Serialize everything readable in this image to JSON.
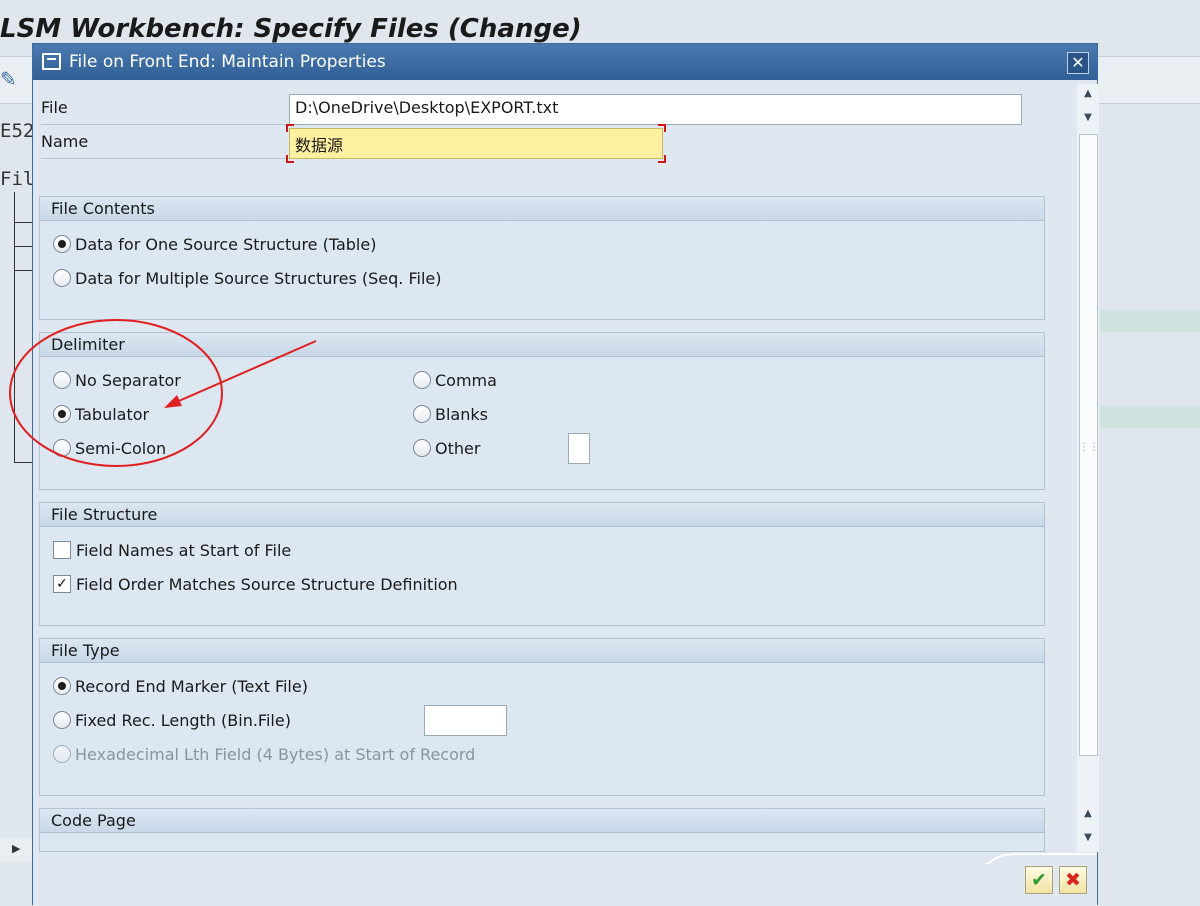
{
  "background": {
    "title": "LSM Workbench: Specify Files (Change)",
    "text_e52": "E52",
    "text_fil": "Fil"
  },
  "dialog": {
    "title": "File on Front End: Maintain Properties",
    "file_label": "File",
    "file_value": "D:\\OneDrive\\Desktop\\EXPORT.txt",
    "name_label": "Name",
    "name_value": "数据源",
    "file_contents": {
      "header": "File Contents",
      "options": [
        "Data for One Source Structure (Table)",
        "Data for Multiple Source Structures (Seq. File)"
      ],
      "selected": 0
    },
    "delimiter": {
      "header": "Delimiter",
      "options": [
        "No Separator",
        "Tabulator",
        "Semi-Colon",
        "Comma",
        "Blanks",
        "Other"
      ],
      "selected": "Tabulator"
    },
    "file_structure": {
      "header": "File Structure",
      "options": [
        "Field Names at Start of File",
        "Field Order Matches Source Structure Definition"
      ],
      "checked": [
        false,
        true
      ]
    },
    "file_type": {
      "header": "File Type",
      "options": [
        "Record End Marker (Text File)",
        "Fixed Rec. Length (Bin.File)",
        "Hexadecimal Lth Field (4 Bytes) at Start of Record"
      ],
      "selected": 0
    },
    "code_page": {
      "header": "Code Page"
    },
    "buttons": {
      "ok_icon": "checkmark-icon",
      "cancel_icon": "x-icon"
    },
    "colors": {
      "title_bar": "#2f5f95",
      "required_field": "#fdf0a0",
      "annotation": "#e02020"
    }
  }
}
